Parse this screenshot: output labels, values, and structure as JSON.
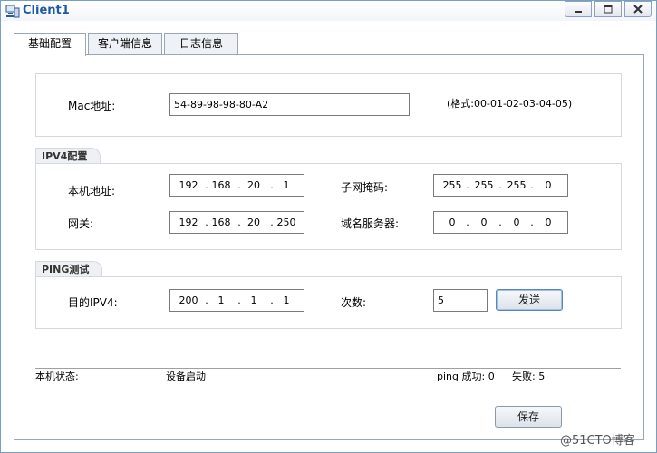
{
  "window": {
    "title": "Client1"
  },
  "tabs": [
    {
      "label": "基础配置",
      "active": true
    },
    {
      "label": "客户端信息",
      "active": false
    },
    {
      "label": "日志信息",
      "active": false
    }
  ],
  "mac": {
    "label": "Mac地址:",
    "value": "54-89-98-98-80-A2",
    "format_hint": "(格式:00-01-02-03-04-05)"
  },
  "ipv4": {
    "group_label": "IPV4配置",
    "local_ip_label": "本机地址:",
    "local_ip": [
      "192",
      "168",
      "20",
      "1"
    ],
    "subnet_label": "子网掩码:",
    "subnet": [
      "255",
      "255",
      "255",
      "0"
    ],
    "gateway_label": "网关:",
    "gateway": [
      "192",
      "168",
      "20",
      "250"
    ],
    "dns_label": "域名服务器:",
    "dns": [
      "0",
      "0",
      "0",
      "0"
    ]
  },
  "ping": {
    "group_label": "PING测试",
    "dest_label": "目的IPV4:",
    "dest": [
      "200",
      "1",
      "1",
      "1"
    ],
    "count_label": "次数:",
    "count": "5",
    "send_label": "发送"
  },
  "status": {
    "label": "本机状态:",
    "value": "设备启动",
    "ping_success": "ping 成功: 0",
    "fail": "失败: 5"
  },
  "save_label": "保存",
  "watermark": "@51CTO博客"
}
